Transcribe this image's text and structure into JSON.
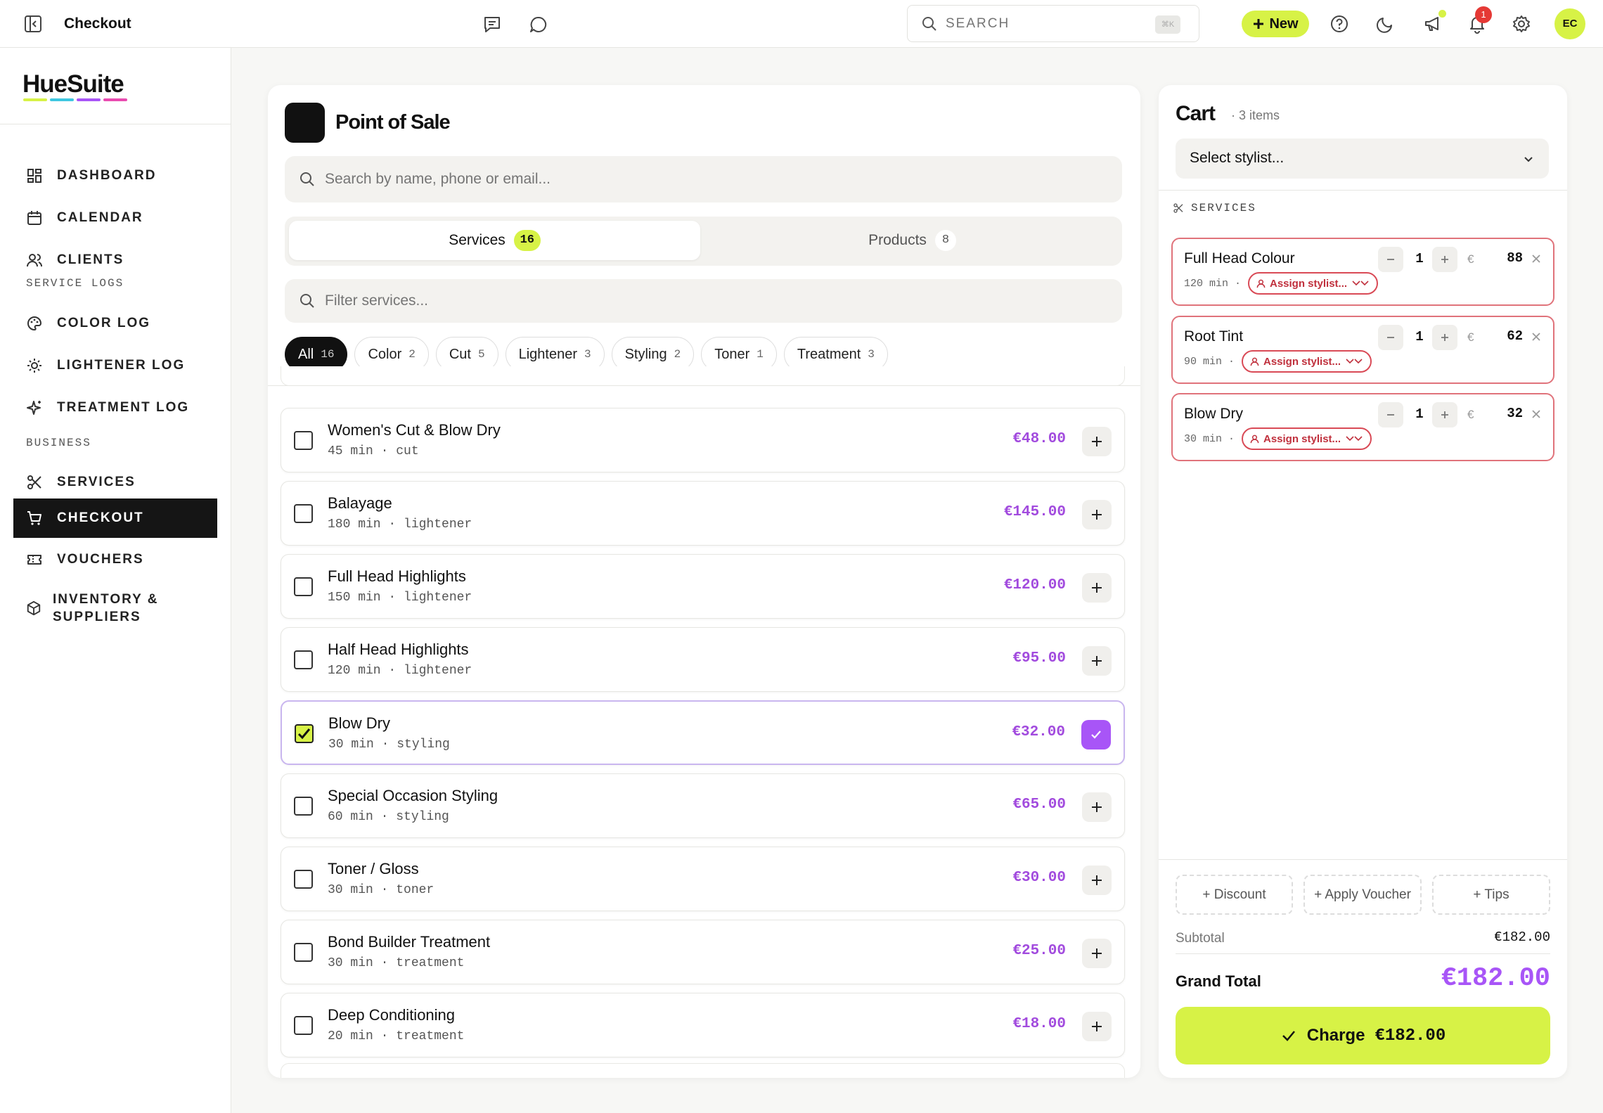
{
  "topbar": {
    "title": "Checkout",
    "search_placeholder": "SEARCH",
    "shortcut": "⌘K",
    "new_label": "New",
    "notifications_count": "1",
    "avatar_initials": "EC"
  },
  "sidebar": {
    "logo": "HueSuite",
    "logo_colors": [
      "#d7f246",
      "#3ec7e0",
      "#a855f7",
      "#e94bb0"
    ],
    "items": [
      {
        "label": "DASHBOARD",
        "icon": "dashboard-icon"
      },
      {
        "label": "CALENDAR",
        "icon": "calendar-icon"
      },
      {
        "label": "CLIENTS",
        "icon": "users-icon"
      }
    ],
    "section_service_logs": "SERVICE LOGS",
    "log_items": [
      {
        "label": "COLOR LOG",
        "icon": "palette-icon"
      },
      {
        "label": "LIGHTENER LOG",
        "icon": "sun-icon"
      },
      {
        "label": "TREATMENT LOG",
        "icon": "sparkle-icon"
      }
    ],
    "section_business": "BUSINESS",
    "business_items": [
      {
        "label": "SERVICES",
        "icon": "scissors-icon"
      },
      {
        "label": "CHECKOUT",
        "icon": "cart-icon",
        "active": true
      },
      {
        "label": "VOUCHERS",
        "icon": "ticket-icon"
      },
      {
        "label_line1": "INVENTORY &",
        "label_line2": "SUPPLIERS",
        "icon": "box-icon"
      }
    ]
  },
  "pos": {
    "title": "Point of Sale",
    "search_placeholder": "Search by name, phone or email...",
    "tabs": [
      {
        "label": "Services",
        "count": "16",
        "active": true
      },
      {
        "label": "Products",
        "count": "8",
        "active": false
      }
    ],
    "filter_placeholder": "Filter services...",
    "chips": [
      {
        "label": "All",
        "count": "16",
        "active": true
      },
      {
        "label": "Color",
        "count": "2"
      },
      {
        "label": "Cut",
        "count": "5"
      },
      {
        "label": "Lightener",
        "count": "3"
      },
      {
        "label": "Styling",
        "count": "2"
      },
      {
        "label": "Toner",
        "count": "1"
      },
      {
        "label": "Treatment",
        "count": "3"
      }
    ],
    "services": [
      {
        "name": "Women's Cut & Blow Dry",
        "meta": "45 min · cut",
        "price": "€48.00",
        "selected": false
      },
      {
        "name": "Balayage",
        "meta": "180 min · lightener",
        "price": "€145.00",
        "selected": false
      },
      {
        "name": "Full Head Highlights",
        "meta": "150 min · lightener",
        "price": "€120.00",
        "selected": false
      },
      {
        "name": "Half Head Highlights",
        "meta": "120 min · lightener",
        "price": "€95.00",
        "selected": false
      },
      {
        "name": "Blow Dry",
        "meta": "30 min · styling",
        "price": "€32.00",
        "selected": true
      },
      {
        "name": "Special Occasion Styling",
        "meta": "60 min · styling",
        "price": "€65.00",
        "selected": false
      },
      {
        "name": "Toner / Gloss",
        "meta": "30 min · toner",
        "price": "€30.00",
        "selected": false
      },
      {
        "name": "Bond Builder Treatment",
        "meta": "30 min · treatment",
        "price": "€25.00",
        "selected": false
      },
      {
        "name": "Deep Conditioning",
        "meta": "20 min · treatment",
        "price": "€18.00",
        "selected": false
      }
    ]
  },
  "cart": {
    "title": "Cart",
    "count_label": "· 3 items",
    "stylist_placeholder": "Select stylist...",
    "section_label": "SERVICES",
    "items": [
      {
        "name": "Full Head Colour",
        "duration": "120 min",
        "qty": "1",
        "currency": "€",
        "amount": "88",
        "assign_label": "Assign stylist..."
      },
      {
        "name": "Root Tint",
        "duration": "90 min",
        "qty": "1",
        "currency": "€",
        "amount": "62",
        "assign_label": "Assign stylist..."
      },
      {
        "name": "Blow Dry",
        "duration": "30 min",
        "qty": "1",
        "currency": "€",
        "amount": "32",
        "assign_label": "Assign stylist..."
      }
    ],
    "discount_label": "+ Discount",
    "voucher_label": "+ Apply Voucher",
    "tips_label": "+ Tips",
    "subtotal_label": "Subtotal",
    "subtotal_value": "€182.00",
    "grand_total_label": "Grand Total",
    "grand_total_value": "€182.00",
    "charge_label": "Charge",
    "charge_amount": "€182.00"
  },
  "colors": {
    "accent_lime": "#d7f246",
    "accent_purple": "#a855f7",
    "price_purple": "#a24bde",
    "cart_border_red": "#e0737b"
  }
}
